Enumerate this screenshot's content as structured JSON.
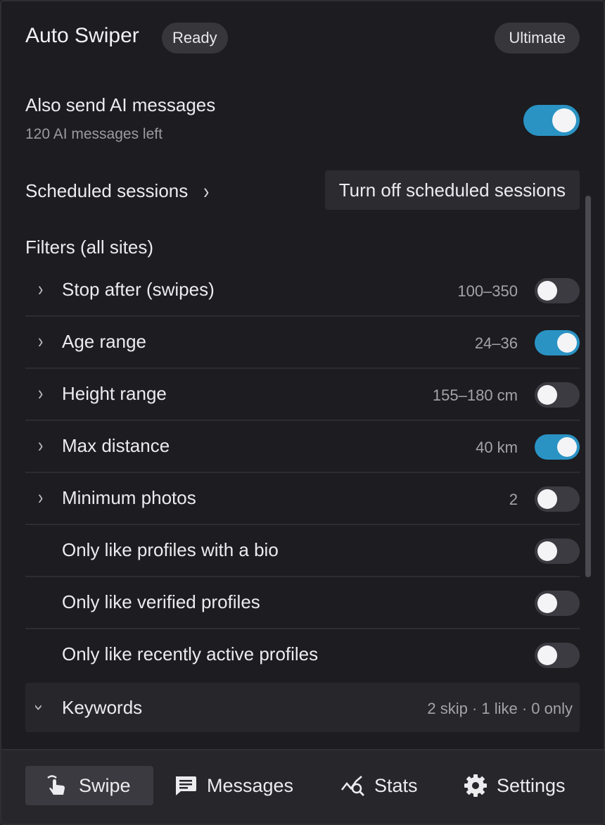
{
  "header": {
    "title": "Auto Swiper",
    "status_badge": "Ready",
    "plan_badge": "Ultimate"
  },
  "ai_messages": {
    "title": "Also send AI messages",
    "subtitle": "120 AI messages left",
    "enabled": true
  },
  "scheduled": {
    "link_label": "Scheduled sessions",
    "button_label": "Turn off scheduled sessions"
  },
  "filters": {
    "title": "Filters (all sites)",
    "rows": [
      {
        "label": "Stop after (swipes)",
        "value": "100–350",
        "expandable": true,
        "enabled": false
      },
      {
        "label": "Age range",
        "value": "24–36",
        "expandable": true,
        "enabled": true
      },
      {
        "label": "Height range",
        "value": "155–180 cm",
        "expandable": true,
        "enabled": false
      },
      {
        "label": "Max distance",
        "value": "40 km",
        "expandable": true,
        "enabled": true
      },
      {
        "label": "Minimum photos",
        "value": "2",
        "expandable": true,
        "enabled": false
      },
      {
        "label": "Only like profiles with a bio",
        "value": "",
        "expandable": false,
        "enabled": false
      },
      {
        "label": "Only like verified profiles",
        "value": "",
        "expandable": false,
        "enabled": false
      },
      {
        "label": "Only like recently active profiles",
        "value": "",
        "expandable": false,
        "enabled": false
      }
    ]
  },
  "keywords": {
    "label": "Keywords",
    "summary": "2 skip · 1 like · 0 only"
  },
  "nav": {
    "swipe": "Swipe",
    "messages": "Messages",
    "stats": "Stats",
    "settings": "Settings",
    "active": "swipe"
  },
  "colors": {
    "accent": "#2a93c4",
    "background": "#1c1c21",
    "toggle_off": "#3b3b41"
  }
}
